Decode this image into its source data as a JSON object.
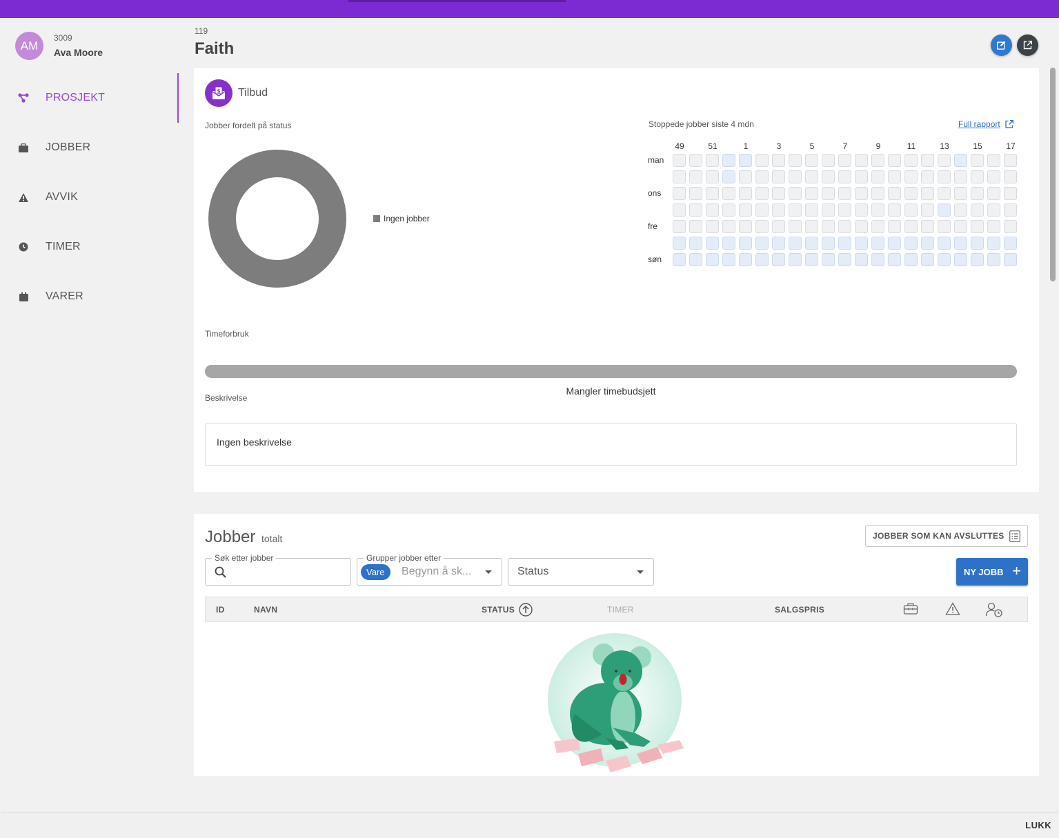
{
  "user": {
    "initials": "AM",
    "id": "3009",
    "name": "Ava Moore"
  },
  "nav": [
    {
      "label": "PROSJEKT",
      "icon": "project-icon",
      "active": true
    },
    {
      "label": "JOBBER",
      "icon": "briefcase-icon",
      "active": false
    },
    {
      "label": "AVVIK",
      "icon": "warning-icon",
      "active": false
    },
    {
      "label": "TIMER",
      "icon": "clock-icon",
      "active": false
    },
    {
      "label": "VARER",
      "icon": "box-icon",
      "active": false
    }
  ],
  "project": {
    "number": "119",
    "title": "Faith"
  },
  "card": {
    "type_label": "Tilbud",
    "status_section_label": "Jobber fordelt på status",
    "legend_label": "Ingen jobber",
    "stopped_label": "Stoppede jobber siste 4 mdn",
    "full_report": "Full rapport",
    "time_label": "Timeforbruk",
    "time_progress": 0,
    "missing_budget": "Mangler timebudsjett",
    "desc_label": "Beskrivelse",
    "desc_text": "Ingen beskrivelse"
  },
  "chart_data": {
    "type": "heatmap",
    "week_labels": [
      "49",
      "51",
      "1",
      "3",
      "5",
      "7",
      "9",
      "11",
      "13",
      "15",
      "17"
    ],
    "day_labels": [
      "man",
      "",
      "ons",
      "",
      "fre",
      "",
      "søn"
    ],
    "weeks": 21,
    "highlighted": [
      [
        0,
        3
      ],
      [
        0,
        4
      ],
      [
        0,
        17
      ],
      [
        1,
        3
      ],
      [
        3,
        16
      ],
      [
        5,
        0
      ],
      [
        5,
        1
      ],
      [
        5,
        2
      ],
      [
        5,
        3
      ],
      [
        5,
        4
      ],
      [
        5,
        5
      ],
      [
        5,
        6
      ],
      [
        5,
        7
      ],
      [
        5,
        8
      ],
      [
        5,
        9
      ],
      [
        5,
        10
      ],
      [
        5,
        11
      ],
      [
        5,
        12
      ],
      [
        5,
        13
      ],
      [
        5,
        14
      ],
      [
        5,
        15
      ],
      [
        5,
        16
      ],
      [
        5,
        17
      ],
      [
        5,
        18
      ],
      [
        5,
        19
      ],
      [
        5,
        20
      ],
      [
        6,
        0
      ],
      [
        6,
        1
      ],
      [
        6,
        2
      ],
      [
        6,
        3
      ],
      [
        6,
        4
      ],
      [
        6,
        5
      ],
      [
        6,
        6
      ],
      [
        6,
        7
      ],
      [
        6,
        8
      ],
      [
        6,
        9
      ],
      [
        6,
        10
      ],
      [
        6,
        11
      ],
      [
        6,
        12
      ],
      [
        6,
        13
      ],
      [
        6,
        14
      ],
      [
        6,
        15
      ],
      [
        6,
        16
      ],
      [
        6,
        17
      ],
      [
        6,
        18
      ],
      [
        6,
        19
      ],
      [
        6,
        20
      ]
    ],
    "colors": {
      "empty": "#f0f1f3",
      "highlighted": "#e3ecf8"
    }
  },
  "jobs": {
    "title": "Jobber",
    "subtitle": "totalt",
    "closable_btn": "JOBBER SOM KAN AVSLUTTES",
    "search_label": "Søk etter jobber",
    "group_label": "Grupper jobber etter",
    "group_chip": "Vare",
    "group_placeholder": "Begynn å sk...",
    "status_select": "Status",
    "new_job": "NY JOBB",
    "columns": {
      "id": "ID",
      "name": "NAVN",
      "status": "STATUS",
      "hours": "TIMER",
      "price": "SALGSPRIS"
    }
  },
  "footer": {
    "close": "LUKK"
  },
  "colors": {
    "topbar": "#7b2bd1",
    "accent": "#9b45d6",
    "primary": "#2e72c8"
  }
}
